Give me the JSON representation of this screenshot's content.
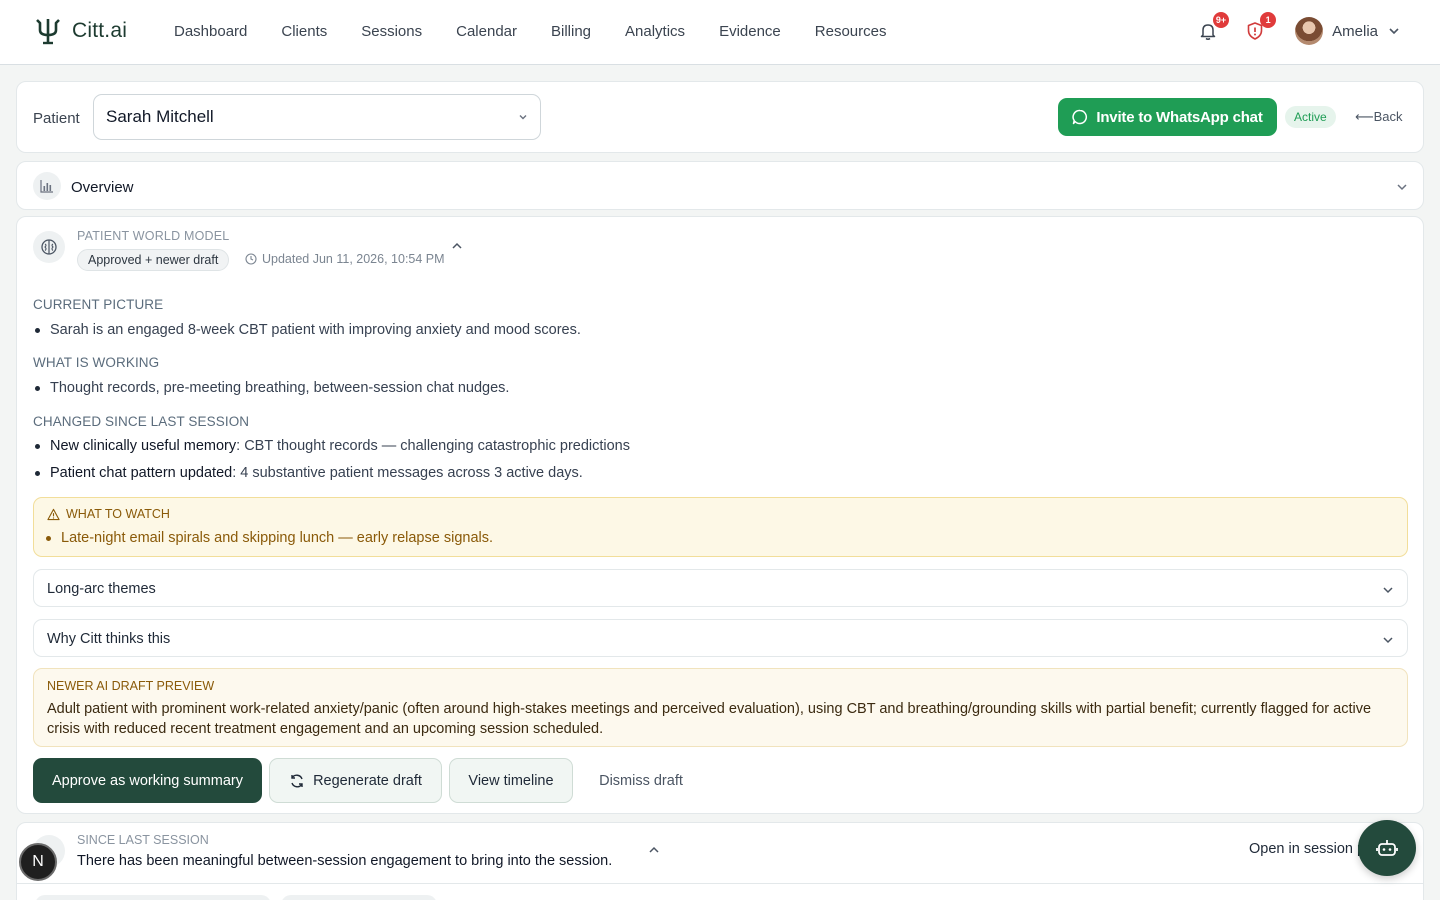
{
  "brand": {
    "name": "Citt.ai"
  },
  "nav": {
    "links": [
      "Dashboard",
      "Clients",
      "Sessions",
      "Calendar",
      "Billing",
      "Analytics",
      "Evidence",
      "Resources"
    ],
    "notifications_badge": "9+",
    "alerts_badge": "1",
    "user_name": "Amelia"
  },
  "patient_bar": {
    "label": "Patient",
    "selected": "Sarah Mitchell",
    "whatsapp_label": "Invite to WhatsApp chat",
    "status": "Active",
    "back_label": "Back"
  },
  "overview": {
    "title": "Overview"
  },
  "world_model": {
    "kicker": "PATIENT WORLD MODEL",
    "status": "Approved + newer draft",
    "updated": "Updated Jun 11, 2026, 10:54 PM",
    "current_picture": {
      "heading": "CURRENT PICTURE",
      "items": [
        "Sarah is an engaged 8-week CBT patient with improving anxiety and mood scores."
      ]
    },
    "what_is_working": {
      "heading": "WHAT IS WORKING",
      "items": [
        "Thought records, pre-meeting breathing, between-session chat nudges."
      ]
    },
    "changed": {
      "heading": "CHANGED SINCE LAST SESSION",
      "items": [
        {
          "label": "New clinically useful memory",
          "text": ": CBT thought records — challenging catastrophic predictions"
        },
        {
          "label": "Patient chat pattern updated",
          "text": ": 4 substantive patient messages across 3 active days."
        }
      ]
    },
    "watch": {
      "heading": "WHAT TO WATCH",
      "items": [
        "Late-night email spirals and skipping lunch — early relapse signals."
      ]
    },
    "accordions": [
      "Long-arc themes",
      "Why Citt thinks this"
    ],
    "draft": {
      "heading": "NEWER AI DRAFT PREVIEW",
      "text": "Adult patient with prominent work-related anxiety/panic (often around high-stakes meetings and perceived evaluation), using CBT and breathing/grounding skills with partial benefit; currently flagged for active crisis with reduced recent treatment engagement and an upcoming session scheduled."
    },
    "actions": {
      "approve": "Approve as working summary",
      "regenerate": "Regenerate draft",
      "timeline": "View timeline",
      "dismiss": "Dismiss draft"
    }
  },
  "since_last_session": {
    "kicker": "SINCE LAST SESSION",
    "title": "There has been meaningful between-session engagement to bring into the session.",
    "open_label": "Open in session p"
  },
  "fab": {
    "n_label": "N"
  },
  "colors": {
    "brand_green": "#234a3c",
    "whatsapp_green": "#1f9d55",
    "alert_red": "#e03b3b",
    "watch_amber": "#8a5a09"
  }
}
